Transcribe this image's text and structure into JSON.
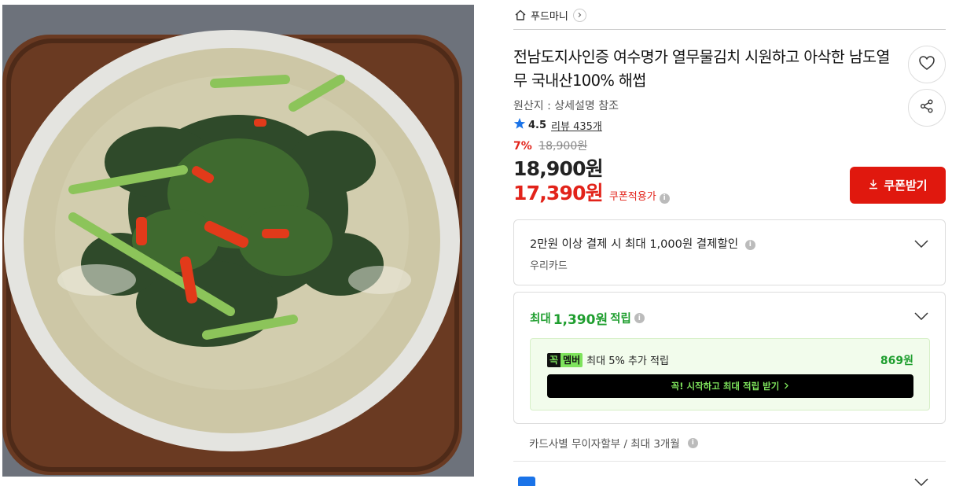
{
  "seller": {
    "name": "푸드마니"
  },
  "product": {
    "title": "전남도지사인증 여수명가 열무물김치 시원하고 아삭한 남도열무 국내산100% 해썹",
    "origin": "원산지 : 상세설명 참조",
    "rating": "4.5",
    "review_label": "리뷰 435개",
    "discount_rate": "7%",
    "original_price": "18,900원",
    "price": "18,900원",
    "coupon_price": "17,390원",
    "coupon_price_label": "쿠폰적용가"
  },
  "actions": {
    "coupon_button": "쿠폰받기"
  },
  "payment_discount": {
    "title": "2만원 이상 결제 시 최대 1,000원 결제할인",
    "card": "우리카드"
  },
  "points": {
    "prefix": "최대",
    "amount": "1,390원",
    "suffix": "적립",
    "member_badge_left": "꼭",
    "member_badge_right": "멤버",
    "member_text": "최대 5% 추가 적립",
    "member_amount": "869원",
    "member_button": "꼭! 시작하고 최대 적립 받기"
  },
  "installment": "카드사별 무이자할부 / 최대 3개월",
  "colors": {
    "accent_red": "#e0180e",
    "point_green": "#1f9e2f",
    "member_green": "#7ee35c"
  },
  "icons": [
    "home-icon",
    "chevron-right-icon",
    "heart-icon",
    "share-icon",
    "star-icon",
    "download-icon",
    "info-icon",
    "chevron-down-icon"
  ]
}
